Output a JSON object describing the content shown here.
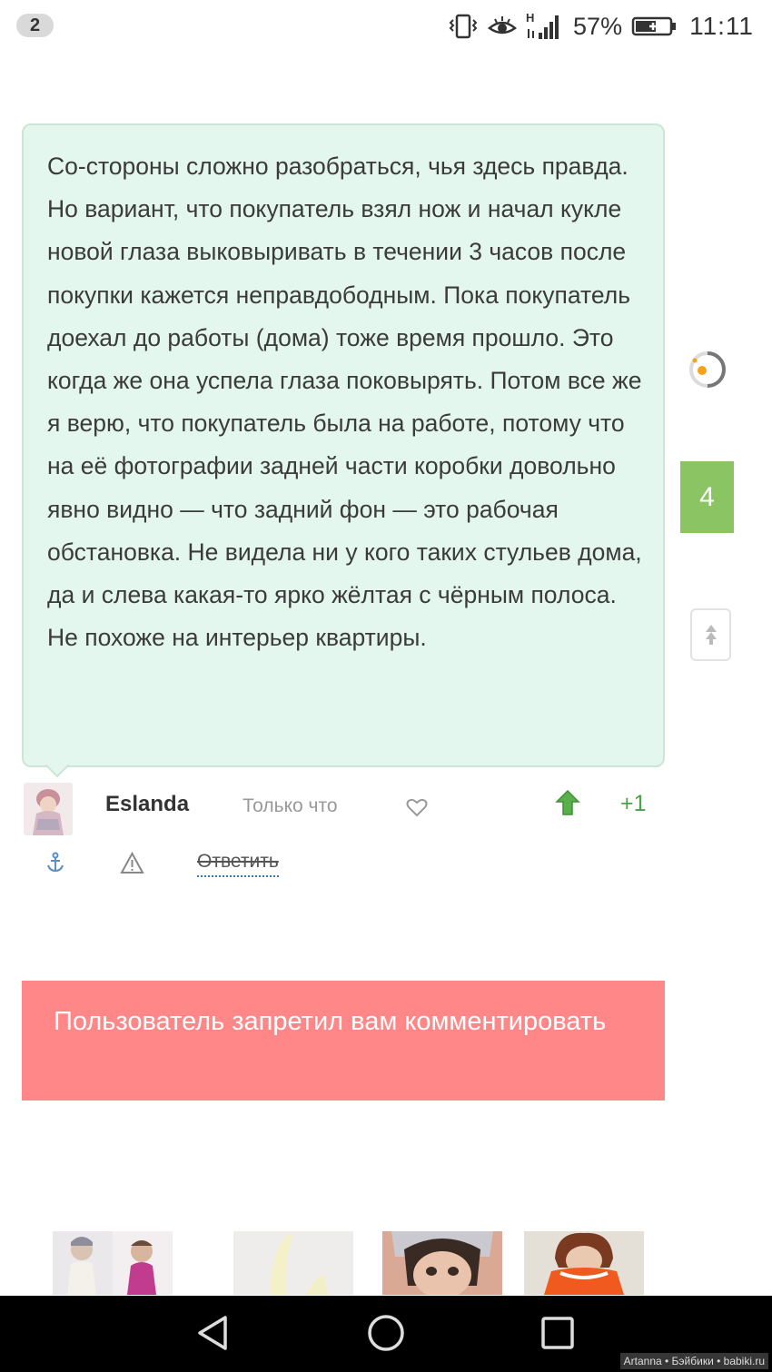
{
  "status_bar": {
    "notification_count": "2",
    "network_label": "H",
    "battery_percent": "57%",
    "time": "11:11",
    "icons": [
      "vibrate-icon",
      "eye-comfort-icon",
      "signal-icon",
      "battery-charging-icon"
    ]
  },
  "comment": {
    "text": "Со-стороны сложно разобраться, чья здесь правда. Но вариант, что покупатель взял нож и начал кукле новой глаза выковыривать в течении 3 часов после покупки кажется неправдободным. Пока покупатель доехал до работы (дома) тоже время прошло. Это когда же она успела глаза поковырять. Потом все же я верю, что покупатель была на работе, потому что на её фотографии задней части коробки довольно явно видно — что задний фон — это рабочая обстановка. Не видела ни у кого таких стульев дома, да и слева какая-то ярко жёлтая с чёрным полоса. Не похоже на интерьер квартиры.",
    "author": "Eslanda",
    "time": "Только что",
    "score": "+1",
    "reply_label": "Ответить"
  },
  "side": {
    "count": "4"
  },
  "ban_notice": {
    "text": "Пользователь запретил вам комментировать"
  },
  "footer": {
    "watermark": "Artanna • Бэйбики • babiki.ru"
  },
  "colors": {
    "bubble_bg": "#e4f7ee",
    "count_bg": "#8bc563",
    "ban_bg": "#ff8787",
    "score_green": "#4aa34a"
  }
}
